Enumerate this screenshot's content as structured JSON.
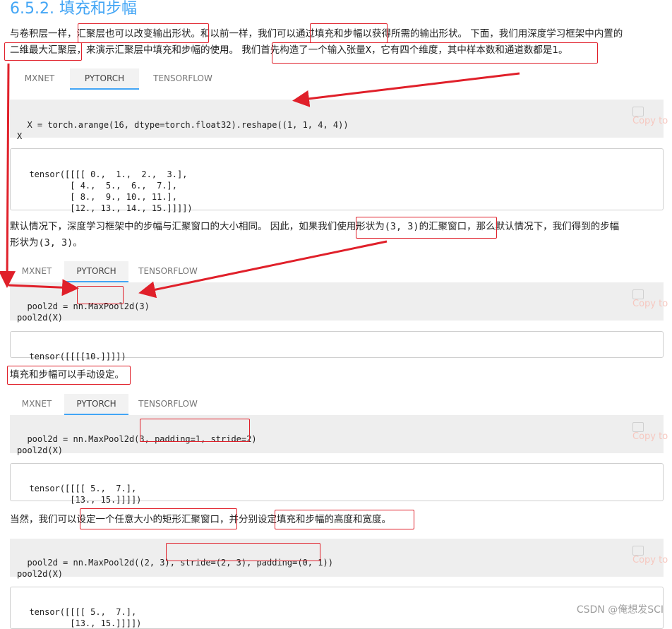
{
  "heading": "6.5.2. 填充和步幅",
  "para1": {
    "line1": [
      "与卷积层一样，",
      "汇聚层也可以改变输出形状。",
      "和以前一样，我们可以",
      "通过填充和步幅",
      "以获得所需的输出形状。 下面，我们用深度学习框架中内置的"
    ],
    "line2": [
      "二维最大汇聚层",
      "，来演示汇聚层中填充和步幅的使用。 我们首先构造了一个输入张量",
      "X",
      "，它有四个维度，其中样本数和通道数都是1。"
    ]
  },
  "tabs": {
    "mxnet": "MXNET",
    "pytorch": "PYTORCH",
    "tensorflow": "TENSORFLOW"
  },
  "copy_label": "Copy to",
  "block1": {
    "code": "X = torch.arange(16, dtype=torch.float32).reshape((1, 1, 4, 4))\nX",
    "output": "tensor([[[[ 0.,  1.,  2.,  3.],\n          [ 4.,  5.,  6.,  7.],\n          [ 8.,  9., 10., 11.],\n          [12., 13., 14., 15.]]]])"
  },
  "para2": {
    "line1": [
      "默认情况下，深度学习框架中的步幅与汇聚窗口的大小相同。 因此，如果我们",
      "使用形状为",
      "(3, 3)",
      "的汇聚窗口",
      "，那么默认情况下，我们得到的步幅"
    ],
    "line2": [
      "形状为",
      "(3, 3)",
      "。"
    ]
  },
  "block2": {
    "code": "pool2d = nn.MaxPool2d(3)\npool2d(X)",
    "output": "tensor([[[[10.]]]])"
  },
  "para3": "填充和步幅可以手动设定。",
  "block3": {
    "code": "pool2d = nn.MaxPool2d(3, padding=1, stride=2)\npool2d(X)",
    "output": "tensor([[[[ 5.,  7.],\n          [13., 15.]]]])"
  },
  "para4": [
    "当然，我们可以",
    "设定一个任意大小的矩形汇聚窗口",
    "，并分别",
    "设定填充和步幅的高度和宽度",
    "。"
  ],
  "block4": {
    "code": "pool2d = nn.MaxPool2d((2, 3), stride=(2, 3), padding=(0, 1))\npool2d(X)",
    "output": "tensor([[[[ 5.,  7.],\n          [13., 15.]]]])"
  },
  "watermark": "CSDN @俺想发SCI",
  "annotation_color": "#e0202a",
  "accent_color": "#42a5f5"
}
